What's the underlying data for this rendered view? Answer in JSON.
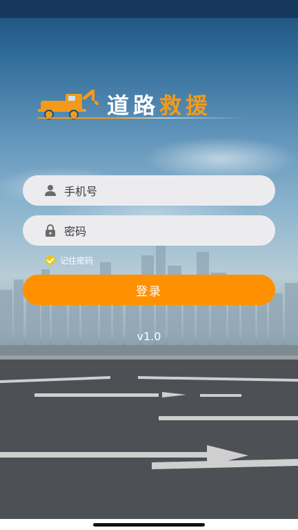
{
  "app": {
    "logo_text_white": "道路",
    "logo_text_orange": "救援"
  },
  "form": {
    "phone_placeholder": "手机号",
    "password_placeholder": "密码",
    "remember_label": "记住密码",
    "remember_checked": true,
    "login_label": "登录"
  },
  "footer": {
    "version": "v1.0"
  },
  "icons": {
    "logo": "tow-truck-icon",
    "phone": "user-icon",
    "password": "lock-icon",
    "remember": "check-circle-icon"
  },
  "colors": {
    "accent": "#ff9100",
    "logo_orange": "#f39a1a",
    "checkbox": "#e8c81a",
    "field_bg": "#ececef"
  }
}
